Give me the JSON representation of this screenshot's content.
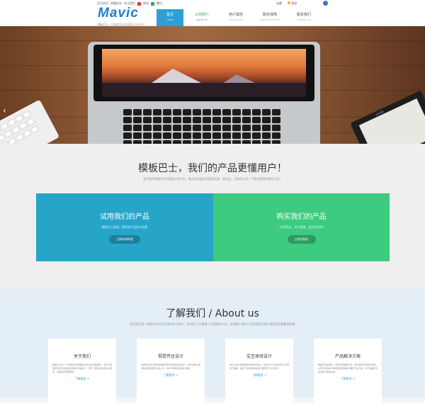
{
  "header": {
    "top_links": [
      "设为首页",
      "收藏本站",
      "关注我们",
      "新浪",
      "腾讯"
    ],
    "logo_text": "Mavic",
    "logo_sub": "模板巴士",
    "logo_tagline": "中国最专业的模板交易平台",
    "nav": [
      {
        "label": "首页",
        "en": "HOME",
        "active": true
      },
      {
        "label": "公司简介",
        "en": "ABOUT US",
        "active": false
      },
      {
        "label": "用户案例",
        "en": "OUR CLIENTS",
        "active": false
      },
      {
        "label": "服务保障",
        "en": "SERVICE SECURITY",
        "active": false
      },
      {
        "label": "联系我们",
        "en": "CONTACT US",
        "active": false
      }
    ],
    "login_label": "油墨",
    "signin_label": "登录"
  },
  "hero": {
    "kindle_label": "kindle"
  },
  "tagline": {
    "title": "模板巴士，我们的产品更懂用户！",
    "subtitle": "我们是中国最专业的模板交易平台，整合全网最全的模板资源，给站长，互联网公司一个解决营销的最好方案！"
  },
  "cards": {
    "try": {
      "title": "试用我们的产品",
      "desc": "模板巴士承诺，我们的产品永久免费",
      "button": "立即申请体验"
    },
    "buy": {
      "title": "购买我们的产品",
      "desc": "一次性购买，永久使用，送技术支持！",
      "button": "立即去购买"
    }
  },
  "about": {
    "title": "了解我们 / About us",
    "subtitle": "我们团队是一群热爱设计及开发的有为青年，在中国·工作着最人们需要的产品，协助客户提升产品体验和品牌价值是我们最重要的事",
    "items": [
      {
        "title": "关于我们",
        "desc": "模板巴士是一个中国专业领域服务商的设计模板团队，专注于模型网页设计和移动应用用户界面设计，我们一群业界资深设计团队，并提供高质量服务。",
        "more": "了解更多 >"
      },
      {
        "title": "视觉传达设计",
        "desc": "视觉传达设计是利用视觉符号来传递信息的设计，用符合用户需求的视觉效果传达给公众，用户获得更好的用户体验。",
        "more": "了解更多 >"
      },
      {
        "title": "交互体验设计",
        "desc": "我们以用户需求的用户体验为核心，将用户与产品交互的行为更易于理解，提供了最佳的体验设计规范用于交互设计。",
        "more": "了解更多 >"
      },
      {
        "title": "产品解决方案",
        "desc": "根据产品的特性，进行市场数据分析，用户研究及竞争分析等，以及专业的用户体验团队帮助客户确定产品方向，为产品提供专业的用户解决方案。",
        "more": "了解更多 >"
      }
    ]
  }
}
